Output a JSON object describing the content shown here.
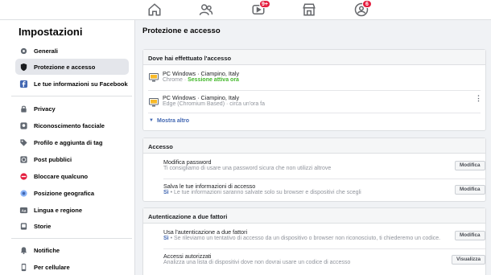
{
  "topbar": {
    "badges": {
      "watch": "9+",
      "groups": "6"
    }
  },
  "sidebar": {
    "title": "Impostazioni",
    "items": [
      {
        "label": "Generali",
        "icon": "gear-icon"
      },
      {
        "label": "Protezione e accesso",
        "icon": "shield-icon"
      },
      {
        "label": "Le tue informazioni su Facebook",
        "icon": "facebook-icon"
      },
      {
        "label": "Privacy",
        "icon": "lock-icon"
      },
      {
        "label": "Riconoscimento facciale",
        "icon": "face-icon"
      },
      {
        "label": "Profilo e aggiunta di tag",
        "icon": "tag-icon"
      },
      {
        "label": "Post pubblici",
        "icon": "globe-icon"
      },
      {
        "label": "Bloccare qualcuno",
        "icon": "block-icon"
      },
      {
        "label": "Posizione geografica",
        "icon": "location-icon"
      },
      {
        "label": "Lingua e regione",
        "icon": "language-icon"
      },
      {
        "label": "Storie",
        "icon": "stories-icon"
      },
      {
        "label": "Notifiche",
        "icon": "bell-icon"
      },
      {
        "label": "Per cellulare",
        "icon": "mobile-icon"
      }
    ]
  },
  "main": {
    "title": "Protezione e accesso",
    "login_section": {
      "header": "Dove hai effettuato l'accesso",
      "sessions": [
        {
          "device": "PC Windows · Ciampino, Italy",
          "browser": "Chrome · ",
          "status": "Sessione attiva ora"
        },
        {
          "device": "PC Windows · Ciampino, Italy",
          "browser": "Edge (Chromium Based) · ",
          "status": "circa un'ora fa"
        }
      ],
      "more": "Mostra altro"
    },
    "access_section": {
      "header": "Accesso",
      "rows": [
        {
          "title": "Modifica password",
          "desc": "Ti consigliamo di usare una password sicura che non utilizzi altrove",
          "button": "Modifica"
        },
        {
          "title": "Salva le tue informazioni di accesso",
          "prefix": "Sì",
          "desc": " • Le tue informazioni saranno salvate solo su browser e dispositivi che scegli",
          "button": "Modifica"
        }
      ]
    },
    "twofa_section": {
      "header": "Autenticazione a due fattori",
      "rows": [
        {
          "title": "Usa l'autenticazione a due fattori",
          "prefix": "Sì",
          "desc": " • Se rileviamo un tentativo di accesso da un dispositivo o browser non riconosciuto, ti chiederemo un codice.",
          "button": "Modifica"
        },
        {
          "title": "Accessi autorizzati",
          "desc": "Analizza una lista di dispositivi dove non dovrai usare un codice di accesso",
          "button": "Visualizza"
        }
      ]
    }
  }
}
